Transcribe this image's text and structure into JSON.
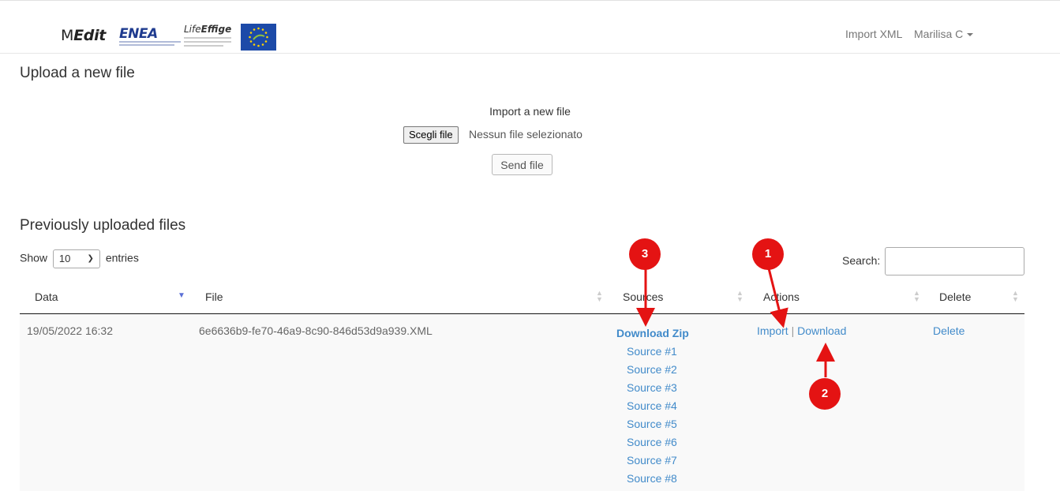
{
  "navbar": {
    "brand_prefix": "M",
    "brand_suffix": "Edit",
    "enea_logo_text": "ENEA",
    "life_logo_prefix": "Life",
    "life_logo_suffix": "Effige",
    "import_xml_link": "Import XML",
    "user_menu_label": "Marilisa C"
  },
  "upload": {
    "heading": "Upload a new file",
    "import_label": "Import a new file",
    "choose_file_button": "Scegli file",
    "no_file_text": "Nessun file selezionato",
    "send_button": "Send file"
  },
  "previous": {
    "heading": "Previously uploaded files",
    "show_prefix": "Show",
    "page_size": "10",
    "show_suffix": "entries",
    "search_label": "Search:",
    "search_value": ""
  },
  "table": {
    "columns": [
      "Data",
      "File",
      "Sources",
      "Actions",
      "Delete"
    ],
    "rows": [
      {
        "date": "19/05/2022 16:32",
        "file": "6e6636b9-fe70-46a9-8c90-846d53d9a939.XML",
        "download_zip": "Download Zip",
        "sources": [
          "Source #1",
          "Source #2",
          "Source #3",
          "Source #4",
          "Source #5",
          "Source #6",
          "Source #7",
          "Source #8"
        ],
        "action_import": "Import",
        "action_separator": "|",
        "action_download": "Download",
        "delete": "Delete"
      }
    ]
  },
  "annotations": {
    "marker_1": "1",
    "marker_2": "2",
    "marker_3": "3",
    "color": "#e41313"
  },
  "colors": {
    "link": "#428bca",
    "sort_active": "#5b6fd6",
    "row_background": "#f9f9f9"
  }
}
